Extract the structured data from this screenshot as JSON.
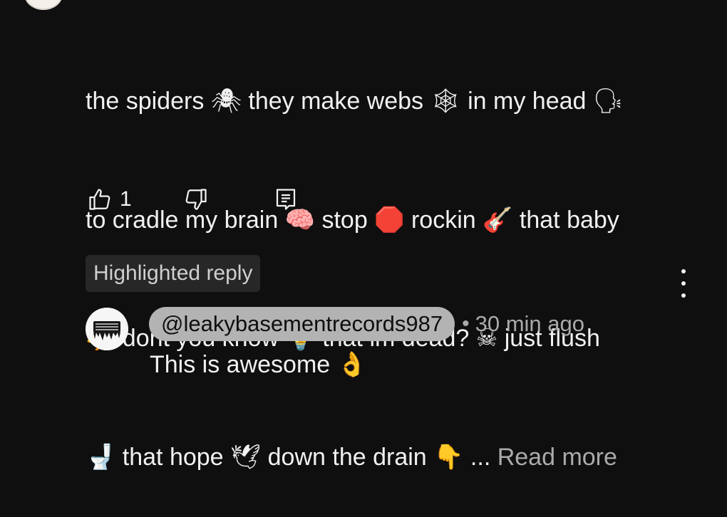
{
  "comment": {
    "lines": [
      [
        "the spiders ",
        "🕷",
        " they make webs ",
        "🕸",
        " in my head ",
        "🗣"
      ],
      [
        "to cradle my brain ",
        "🧠",
        " stop ",
        "🛑",
        " rockin ",
        "🎸",
        " that baby"
      ],
      [
        "🐥",
        " dont you know ",
        "💡",
        " that im dead? ",
        "☠",
        " just flush"
      ],
      [
        "🚽",
        " that hope ",
        "🕊",
        " down the drain ",
        "👇",
        " ... "
      ]
    ],
    "read_more_label": "Read more"
  },
  "actions": {
    "like_count": "1"
  },
  "highlight_badge": "Highlighted reply",
  "reply": {
    "author": "@leakybasementrecords987",
    "separator": "•",
    "time": "30 min ago",
    "text": "This is awesome ",
    "text_emoji": "👌"
  },
  "icons": {
    "top_avatar": "avatar",
    "like": "thumbs-up-icon",
    "dislike": "thumbs-down-icon",
    "reply": "reply-icon",
    "more": "vertical-ellipsis-icon",
    "reply_avatar": "leaky-basement-records-logo"
  },
  "colors": {
    "background": "#0f0f0f",
    "text_primary": "#f1f1f1",
    "text_secondary": "#aaaaaa",
    "badge_background": "#272727",
    "author_chip_background": "#b3b3b3"
  }
}
